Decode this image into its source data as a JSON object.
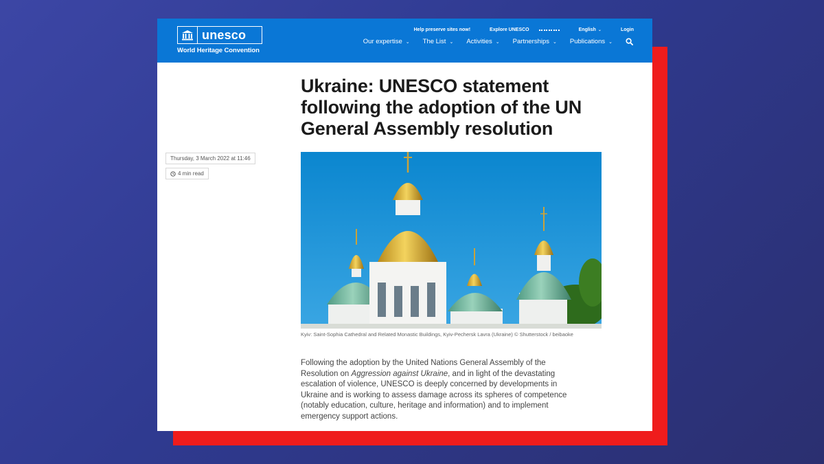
{
  "header": {
    "logo_text": "unesco",
    "logo_subtitle": "World Heritage Convention",
    "utility_nav": {
      "help_link": "Help preserve sites now!",
      "explore_link": "Explore UNESCO",
      "language": "English",
      "login": "Login"
    },
    "main_nav": [
      {
        "label": "Our expertise"
      },
      {
        "label": "The List"
      },
      {
        "label": "Activities"
      },
      {
        "label": "Partnerships"
      },
      {
        "label": "Publications"
      }
    ]
  },
  "article": {
    "title": "Ukraine: UNESCO statement following the adoption of the UN General Assembly resolution",
    "date": "Thursday, 3 March 2022 at 11:46",
    "read_time": "4 min read",
    "image_caption": "Kyiv: Saint-Sophia Cathedral and Related Monastic Buildings, Kyiv-Pechersk Lavra (Ukraine) © Shutterstock / beibaoke",
    "intro_before": "Following the adoption by the United Nations General Assembly of the Resolution on ",
    "intro_italic": "Aggression against Ukraine",
    "intro_after": ", and in light of the devastating escalation of violence, UNESCO is deeply concerned by developments in Ukraine and is working to assess damage across its spheres of competence (notably education, culture, heritage and information) and to implement emergency support actions."
  },
  "colors": {
    "header_blue": "#0a77d6",
    "accent_red": "#ef1c1c",
    "background_blue": "#343f99"
  },
  "icons": [
    "unesco-temple-icon",
    "grid-icon",
    "chevron-down-icon",
    "search-icon",
    "clock-icon"
  ]
}
